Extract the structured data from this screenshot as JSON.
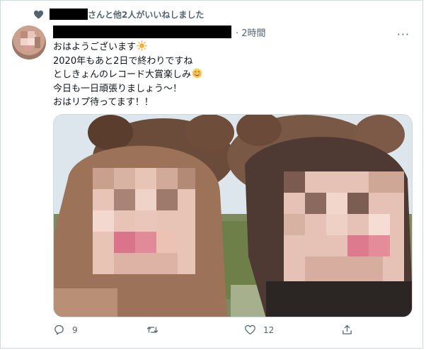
{
  "liked_by": {
    "suffix": "さんと他2人がいいねしました"
  },
  "tweet": {
    "time": "· 2時間",
    "lines": [
      "おはようございます",
      "2020年もあと2日で終わりですね",
      "としきょんのレコード大賞楽しみ",
      "今日も一日頑張りましょう〜！",
      "おはリプ待ってます！！"
    ],
    "emoji_line1": "sun-emoji",
    "emoji_line3": "smiling-face-emoji",
    "more_label": "···"
  },
  "actions": {
    "reply_count": "9",
    "retweet_count": "",
    "like_count": "12"
  },
  "colors": {
    "secondary_text": "#536471",
    "border": "#cfd9de"
  }
}
